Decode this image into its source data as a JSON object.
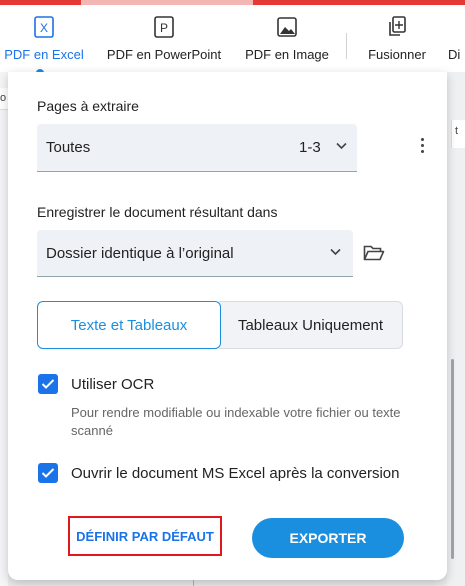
{
  "toolbar": {
    "tools": [
      {
        "label": "PDF en Excel",
        "icon": "excel-x-icon",
        "active": true
      },
      {
        "label": "PDF en PowerPoint",
        "icon": "powerpoint-p-icon",
        "active": false
      },
      {
        "label": "PDF en Image",
        "icon": "image-icon",
        "active": false
      },
      {
        "label": "Fusionner",
        "icon": "merge-icon",
        "active": false
      },
      {
        "label": "Di",
        "icon": "",
        "active": false
      }
    ],
    "excel_glyph": "X",
    "powerpoint_glyph": "P"
  },
  "background": {
    "left_char": "o",
    "right_char": "t"
  },
  "panel": {
    "pages_label": "Pages à extraire",
    "pages_select": {
      "value": "Toutes",
      "range": "1-3"
    },
    "save_label": "Enregistrer le document résultant dans",
    "save_select": {
      "value": "Dossier identique à l’original"
    },
    "mode_toggle": {
      "selected": "Texte et Tableaux",
      "other": "Tableaux Uniquement"
    },
    "options": [
      {
        "label": "Utiliser OCR",
        "checked": true,
        "description": "Pour rendre modifiable ou indexable votre fichier ou texte scanné"
      },
      {
        "label": "Ouvrir le document MS Excel après la conversion",
        "checked": true
      }
    ],
    "buttons": {
      "default_label": "DÉFINIR PAR DÉFAUT",
      "export_label": "EXPORTER"
    }
  },
  "colors": {
    "accent": "#1a8fe0",
    "checkbox": "#1a73e8",
    "highlight_border": "#e0191f",
    "top_bar": "#e53935"
  }
}
